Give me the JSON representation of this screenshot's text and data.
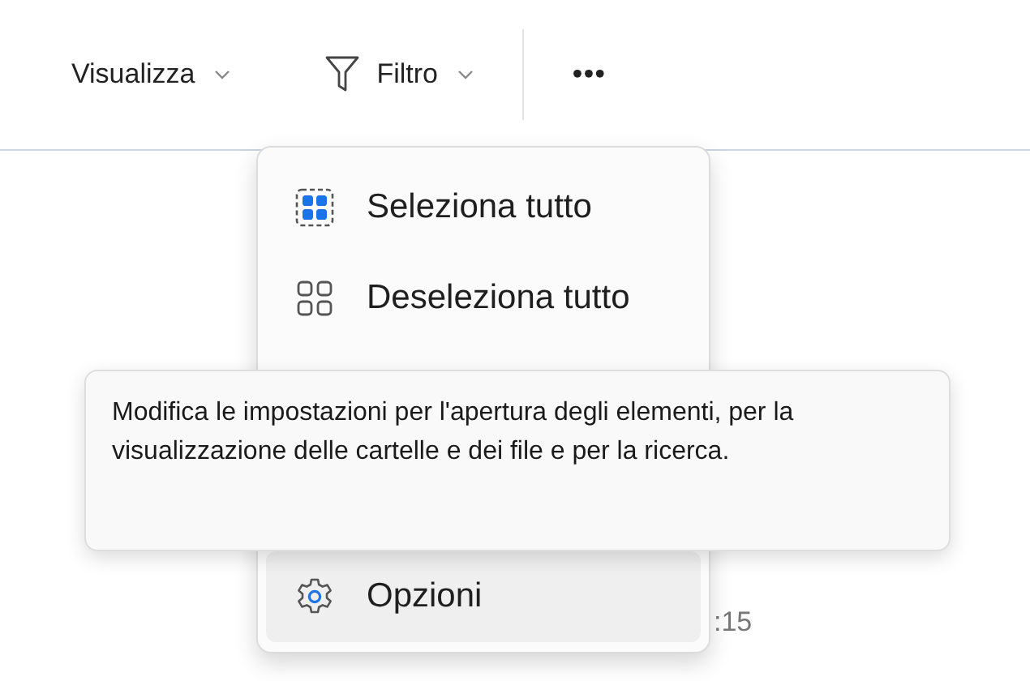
{
  "toolbar": {
    "items": [
      {
        "kind": "dropdown",
        "label": "Visualizza"
      },
      {
        "kind": "filter",
        "label": "Filtro"
      },
      {
        "kind": "more",
        "label": "•••"
      }
    ]
  },
  "background": {
    "time_fragment": ":15"
  },
  "menu": {
    "items": [
      {
        "kind": "select-all",
        "label": "Seleziona tutto",
        "selected": false
      },
      {
        "kind": "deselect-all",
        "label": "Deseleziona tutto",
        "selected": false
      },
      {
        "kind": "options",
        "label": "Opzioni",
        "selected": true
      }
    ]
  },
  "tooltip": {
    "text": "Modifica le impostazioni per l'apertura degli elementi, per la visualizzazione delle cartelle e dei file e per la ricerca."
  }
}
